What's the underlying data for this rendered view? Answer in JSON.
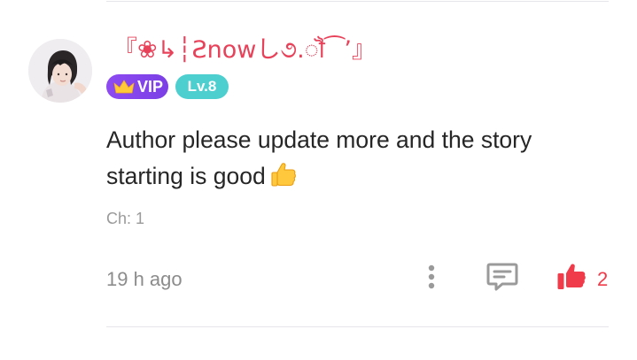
{
  "comment": {
    "username": "『❀↳┆Ƨnowし૭.ॏ⁀’』",
    "badges": {
      "vip_label": "VIP",
      "level_label": "Lv.8"
    },
    "text": "Author please update more and the story starting is good",
    "emoji": "thumbs-up-emoji",
    "chapter": "Ch: 1",
    "time": "19 h ago",
    "likes": "2",
    "icons": {
      "more": "more-vertical-icon",
      "reply": "message-square-icon",
      "like": "thumbs-up-icon"
    },
    "colors": {
      "username": "#e8425a",
      "vip_badge": "#8d4bf1",
      "level_badge": "#4ecfcf",
      "like": "#ef3b4a",
      "icon_gray": "#9a9a9a"
    }
  }
}
